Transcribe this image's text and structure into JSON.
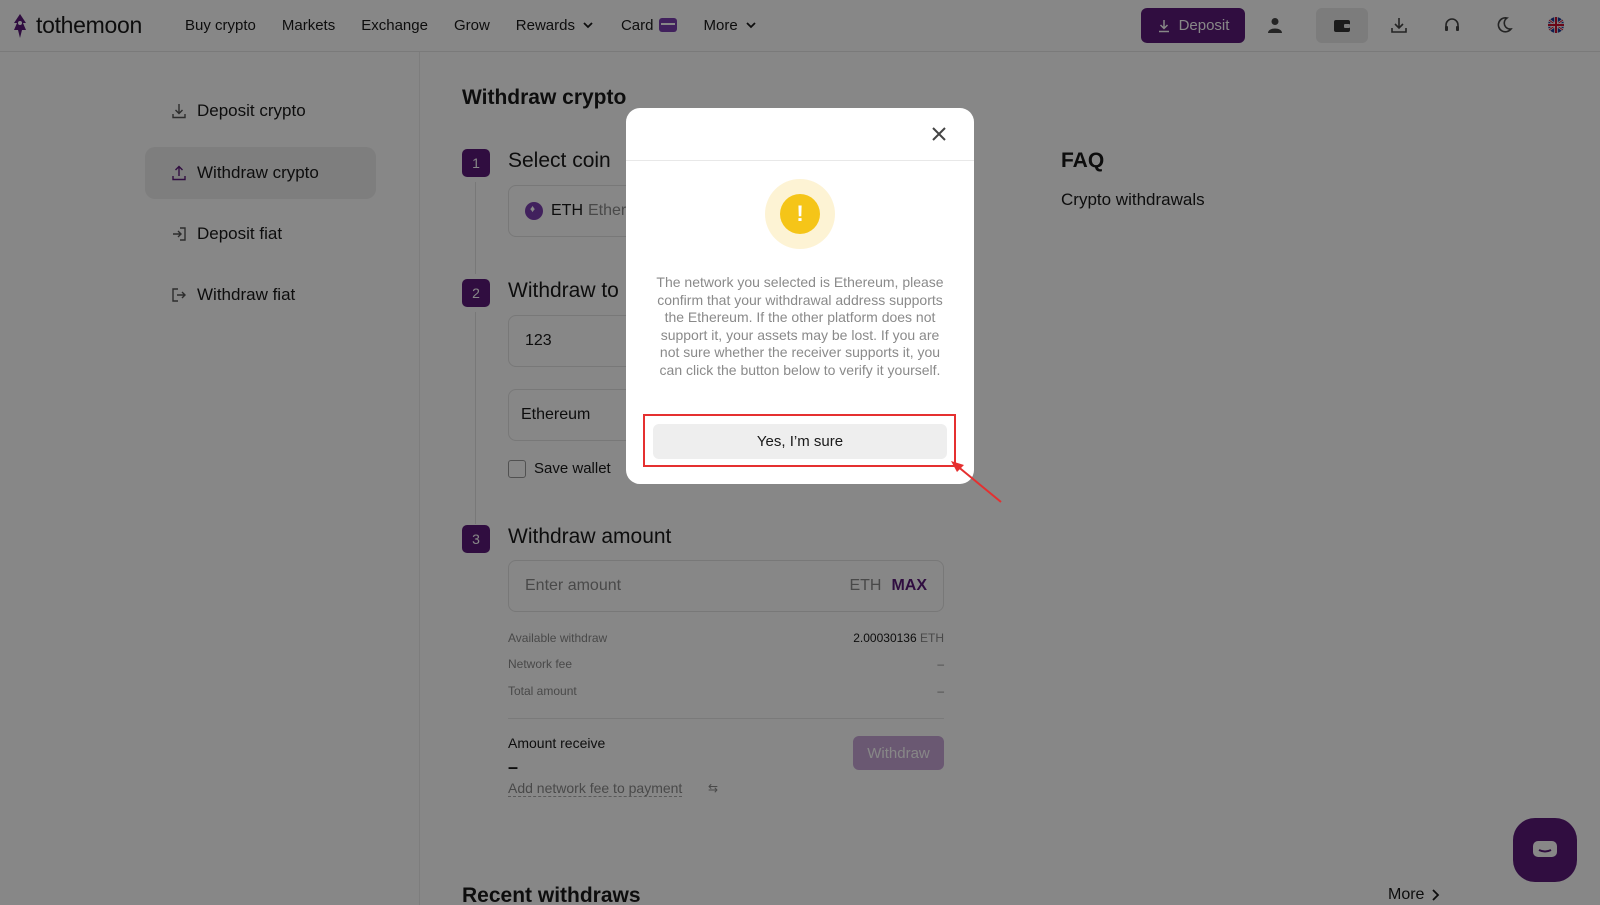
{
  "brand": {
    "name": "tothemoon",
    "accent": "#5c1a7a"
  },
  "nav": {
    "items": [
      {
        "label": "Buy crypto",
        "dropdown": false
      },
      {
        "label": "Markets",
        "dropdown": false
      },
      {
        "label": "Exchange",
        "dropdown": false
      },
      {
        "label": "Grow",
        "dropdown": false
      },
      {
        "label": "Rewards",
        "dropdown": true
      },
      {
        "label": "Card",
        "dropdown": false
      },
      {
        "label": "More",
        "dropdown": true
      }
    ]
  },
  "header": {
    "deposit_label": "Deposit"
  },
  "sidebar": {
    "items": [
      {
        "label": "Deposit crypto",
        "icon": "download-icon",
        "active": false
      },
      {
        "label": "Withdraw crypto",
        "icon": "upload-icon",
        "active": true
      },
      {
        "label": "Deposit fiat",
        "icon": "login-icon",
        "active": false
      },
      {
        "label": "Withdraw fiat",
        "icon": "logout-icon",
        "active": false
      }
    ]
  },
  "main": {
    "title": "Withdraw crypto",
    "step1": {
      "num": "1",
      "title": "Select coin",
      "coin_symbol": "ETH",
      "coin_name": "Ethere"
    },
    "step2": {
      "num": "2",
      "title": "Withdraw to",
      "address_value": "123",
      "network_value": "Ethereum",
      "save_wallet_label": "Save wallet"
    },
    "step3": {
      "num": "3",
      "title": "Withdraw amount",
      "amount_placeholder": "Enter amount",
      "unit": "ETH",
      "max_label": "MAX",
      "available_label": "Available withdraw",
      "available_value": "2.00030136",
      "available_unit": "ETH",
      "fee_label": "Network fee",
      "fee_value": "–",
      "total_label": "Total amount",
      "total_value": "–",
      "receive_label": "Amount receive",
      "receive_value": "–",
      "add_fee_label": "Add network fee to payment",
      "withdraw_label": "Withdraw"
    },
    "recent_title": "Recent withdraws",
    "more_label": "More"
  },
  "faq": {
    "title": "FAQ",
    "item": "Crypto withdrawals"
  },
  "modal": {
    "message": "The network you selected is Ethereum, please confirm that your withdrawal address supports the Ethereum. If the other platform does not support it, your assets may be lost. If you are not sure whether the receiver supports it, you can click the button below to verify it yourself.",
    "confirm_label": "Yes, I’m sure",
    "warning_glyph": "!"
  }
}
